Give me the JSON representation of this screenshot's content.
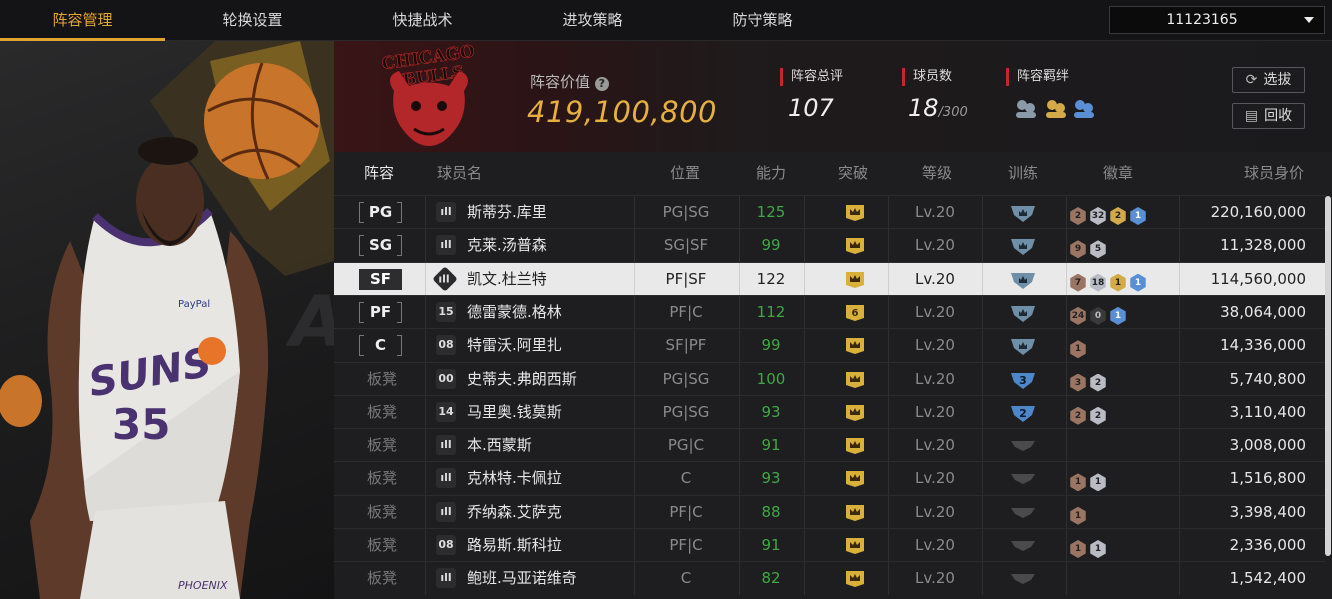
{
  "nav": {
    "tabs": [
      "阵容管理",
      "轮换设置",
      "快捷战术",
      "进攻策略",
      "防守策略"
    ],
    "active_tab": 0,
    "account_id": "11123165"
  },
  "header": {
    "team_logo_text": "CHICAGO BULLS",
    "value_label": "阵容价值",
    "value_help_icon": "?",
    "value": "419,100,800",
    "overall_label": "阵容总评",
    "overall": "107",
    "players_label": "球员数",
    "players_count": "18",
    "players_max": "/300",
    "bond_label": "阵容羁绊",
    "select_button": "选拔",
    "recycle_button": "回收"
  },
  "table": {
    "columns": [
      "阵容",
      "球员名",
      "位置",
      "能力",
      "突破",
      "等级",
      "训练",
      "徽章",
      "球员身价"
    ],
    "rows": [
      {
        "slot": "PG",
        "starter": true,
        "num": "ıll",
        "name": "斯蒂芬.库里",
        "pos": "PG|SG",
        "ability": "125",
        "break": "crown",
        "level": "Lv.20",
        "train": "star",
        "badges": [
          [
            "br",
            "2"
          ],
          [
            "si",
            "32"
          ],
          [
            "go",
            "2"
          ],
          [
            "bl",
            "1"
          ]
        ],
        "price": "220,160,000",
        "selected": false
      },
      {
        "slot": "SG",
        "starter": true,
        "num": "ıll",
        "name": "克莱.汤普森",
        "pos": "SG|SF",
        "ability": "99",
        "break": "crown",
        "level": "Lv.20",
        "train": "star",
        "badges": [
          [
            "br",
            "9"
          ],
          [
            "si",
            "5"
          ]
        ],
        "price": "11,328,000",
        "selected": false
      },
      {
        "slot": "SF",
        "starter": true,
        "num": "ıll",
        "name": "凯文.杜兰特",
        "pos": "PF|SF",
        "ability": "122",
        "break": "crown",
        "level": "Lv.20",
        "train": "star",
        "badges": [
          [
            "br",
            "7"
          ],
          [
            "si",
            "18"
          ],
          [
            "go",
            "1"
          ],
          [
            "bl",
            "1"
          ]
        ],
        "price": "114,560,000",
        "selected": true
      },
      {
        "slot": "PF",
        "starter": true,
        "num": "15",
        "name": "德雷蒙德.格林",
        "pos": "PF|C",
        "ability": "112",
        "break": "6",
        "level": "Lv.20",
        "train": "star",
        "badges": [
          [
            "br",
            "24"
          ],
          [
            "bk",
            "0"
          ],
          [
            "bl",
            "1"
          ]
        ],
        "price": "38,064,000",
        "selected": false
      },
      {
        "slot": "C",
        "starter": true,
        "num": "08",
        "name": "特雷沃.阿里扎",
        "pos": "SF|PF",
        "ability": "99",
        "break": "crown",
        "level": "Lv.20",
        "train": "star",
        "badges": [
          [
            "br",
            "1"
          ]
        ],
        "price": "14,336,000",
        "selected": false
      },
      {
        "slot": "板凳",
        "starter": false,
        "num": "00",
        "name": "史蒂夫.弗朗西斯",
        "pos": "PG|SG",
        "ability": "100",
        "break": "crown",
        "level": "Lv.20",
        "train": "3",
        "badges": [
          [
            "br",
            "3"
          ],
          [
            "si",
            "2"
          ]
        ],
        "price": "5,740,800",
        "selected": false
      },
      {
        "slot": "板凳",
        "starter": false,
        "num": "14",
        "name": "马里奥.钱莫斯",
        "pos": "PG|SG",
        "ability": "93",
        "break": "crown",
        "level": "Lv.20",
        "train": "2",
        "badges": [
          [
            "br",
            "2"
          ],
          [
            "si",
            "2"
          ]
        ],
        "price": "3,110,400",
        "selected": false
      },
      {
        "slot": "板凳",
        "starter": false,
        "num": "ıll",
        "name": "本.西蒙斯",
        "pos": "PG|C",
        "ability": "91",
        "break": "crown",
        "level": "Lv.20",
        "train": "none",
        "badges": [],
        "price": "3,008,000",
        "selected": false
      },
      {
        "slot": "板凳",
        "starter": false,
        "num": "ıll",
        "name": "克林特.卡佩拉",
        "pos": "C",
        "ability": "93",
        "break": "crown",
        "level": "Lv.20",
        "train": "none",
        "badges": [
          [
            "br",
            "1"
          ],
          [
            "si",
            "1"
          ]
        ],
        "price": "1,516,800",
        "selected": false
      },
      {
        "slot": "板凳",
        "starter": false,
        "num": "ıll",
        "name": "乔纳森.艾萨克",
        "pos": "PF|C",
        "ability": "88",
        "break": "crown",
        "level": "Lv.20",
        "train": "none",
        "badges": [
          [
            "br",
            "1"
          ]
        ],
        "price": "3,398,400",
        "selected": false
      },
      {
        "slot": "板凳",
        "starter": false,
        "num": "08",
        "name": "路易斯.斯科拉",
        "pos": "PF|C",
        "ability": "91",
        "break": "crown",
        "level": "Lv.20",
        "train": "none",
        "badges": [
          [
            "br",
            "1"
          ],
          [
            "si",
            "1"
          ]
        ],
        "price": "2,336,000",
        "selected": false
      },
      {
        "slot": "板凳",
        "starter": false,
        "num": "ıll",
        "name": "鲍班.马亚诺维奇",
        "pos": "C",
        "ability": "82",
        "break": "crown",
        "level": "Lv.20",
        "train": "none",
        "badges": [],
        "price": "1,542,400",
        "selected": false
      }
    ]
  },
  "player_art": {
    "team": "SUNS",
    "jersey_number": "35",
    "sponsor": "PayPal",
    "city": "PHOENIX"
  },
  "colors": {
    "accent": "#e2a531",
    "value_gold": "#e6b040",
    "ability_green": "#3fa845",
    "stat_red": "#c0282c",
    "selected_row": "#e9e9e9"
  }
}
